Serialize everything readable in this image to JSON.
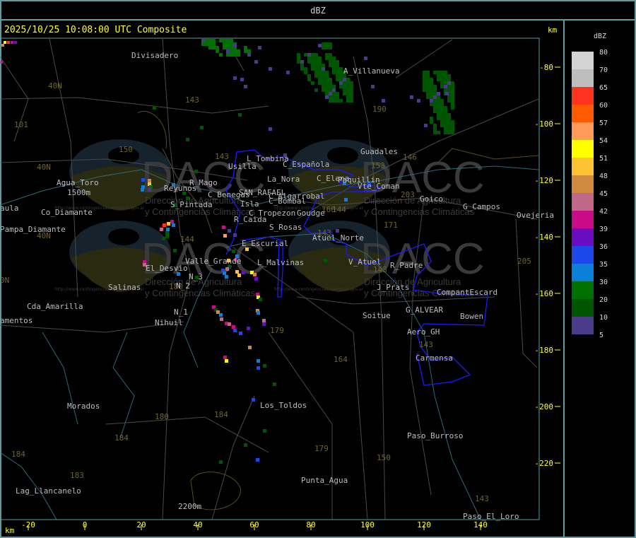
{
  "header": {
    "title": "dBZ"
  },
  "map": {
    "timestamp_label": "2025/10/25 10:08:00 UTC Composite",
    "y_axis_unit": "km",
    "x_axis_unit": "km",
    "x_ticks": [
      -20,
      0,
      20,
      40,
      60,
      80,
      100,
      120,
      140
    ],
    "y_ticks": [
      -80,
      -100,
      -120,
      -140,
      -160,
      -180,
      -200,
      -220
    ],
    "places": [
      "Divisadero",
      "A_Villanueva",
      "Guadales",
      "L_Tombina",
      "C_Española",
      "Usilla",
      "La_Nora",
      "C_Elena",
      "Paquillin",
      "Vte_Coman",
      "Agua_Toro",
      "1500m",
      "Reyunos",
      "R_Mago",
      "C_Benegas",
      "SAN_RAFAEL",
      "C_Algarrobal",
      "C_Bombal",
      "Goico",
      "G_Campos",
      "Ovejeria",
      "Co_Diamante",
      "aula",
      "S_Pintada",
      "Isla",
      "C_Tropezon",
      "Goudge",
      "R_Caida",
      "S_Rosas",
      "Pampa_Diamante",
      "Atuel_Norte",
      "E_Escurial",
      "L_Malvinas",
      "V_Atuel",
      "R_Padre",
      "Valle_Grande",
      "El_Desvio",
      "N_3",
      "Salinas",
      "N_2",
      "J_Prats",
      "CompantEscard",
      "Cda_Amarilla",
      "G_ALVEAR",
      "N_1",
      "Soitue",
      "Bowen",
      "amentos",
      "Nihuil",
      "Aero_GH",
      "Carmensa",
      "Los_Toldos",
      "Morados",
      "Paso_Burroso",
      "Punta_Agua",
      "Lag_Llancanelo",
      "Paso_El_Loro",
      "2200m"
    ],
    "routes": [
      "143",
      "101",
      "40N",
      "150",
      "40N",
      "143",
      "153",
      "146",
      "203",
      "160",
      "171",
      "143",
      "144",
      "205",
      "143",
      "180",
      "179",
      "164",
      "143",
      "180",
      "184",
      "184",
      "179",
      "150",
      "184",
      "183",
      "143",
      "40N",
      "0N",
      "144",
      "190"
    ],
    "watermark": {
      "logo": "DACC",
      "line1": "Dirección de Agricultura",
      "line2": "y Contingencias Climáticas",
      "url": "http://www.contingencias.mendoza.gov.ar"
    }
  },
  "legend": {
    "title": "dBZ",
    "levels": [
      {
        "label": "80",
        "color": "#d4d4d4"
      },
      {
        "label": "70",
        "color": "#bebebe"
      },
      {
        "label": "65",
        "color": "#ff3320"
      },
      {
        "label": "60",
        "color": "#ff5a00"
      },
      {
        "label": "57",
        "color": "#ff9a5a"
      },
      {
        "label": "54",
        "color": "#ffff00"
      },
      {
        "label": "51",
        "color": "#fcc232"
      },
      {
        "label": "48",
        "color": "#d08a40"
      },
      {
        "label": "45",
        "color": "#bf6888"
      },
      {
        "label": "42",
        "color": "#c80c88"
      },
      {
        "label": "39",
        "color": "#6a0cc0"
      },
      {
        "label": "36",
        "color": "#1c48e8"
      },
      {
        "label": "35",
        "color": "#0a80d8"
      },
      {
        "label": "30",
        "color": "#007000"
      },
      {
        "label": "20",
        "color": "#005600"
      },
      {
        "label": "10",
        "color": "#4a3a8a"
      },
      {
        "label": "5",
        "color": null
      }
    ]
  }
}
